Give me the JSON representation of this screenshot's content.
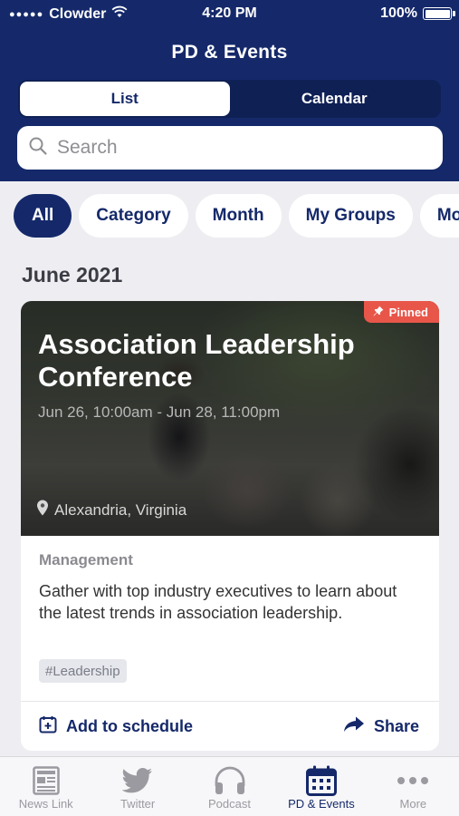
{
  "status_bar": {
    "carrier": "Clowder",
    "time": "4:20 PM",
    "battery": "100%"
  },
  "header": {
    "title": "PD & Events"
  },
  "segments": [
    {
      "label": "List",
      "active": true
    },
    {
      "label": "Calendar",
      "active": false
    }
  ],
  "search": {
    "placeholder": "Search",
    "value": ""
  },
  "filters": [
    "All",
    "Category",
    "Month",
    "My Groups",
    "More"
  ],
  "section": {
    "month": "June 2021"
  },
  "event": {
    "pinned_label": "Pinned",
    "title": "Association Leadership Conference",
    "dates": "Jun 26, 10:00am - Jun 28, 11:00pm",
    "location": "Alexandria, Virginia",
    "category": "Management",
    "description": "Gather with top industry executives to learn about the latest trends in association leadership.",
    "tag": "#Leadership",
    "add_label": "Add to schedule",
    "share_label": "Share"
  },
  "tabbar": [
    {
      "label": "News Link",
      "icon": "newspaper-icon"
    },
    {
      "label": "Twitter",
      "icon": "twitter-icon"
    },
    {
      "label": "Podcast",
      "icon": "headphones-icon"
    },
    {
      "label": "PD & Events",
      "icon": "calendar-icon",
      "active": true
    },
    {
      "label": "More",
      "icon": "more-icon"
    }
  ],
  "colors": {
    "primary": "#15296a",
    "pinned": "#e8564a",
    "background": "#eeeef2"
  }
}
